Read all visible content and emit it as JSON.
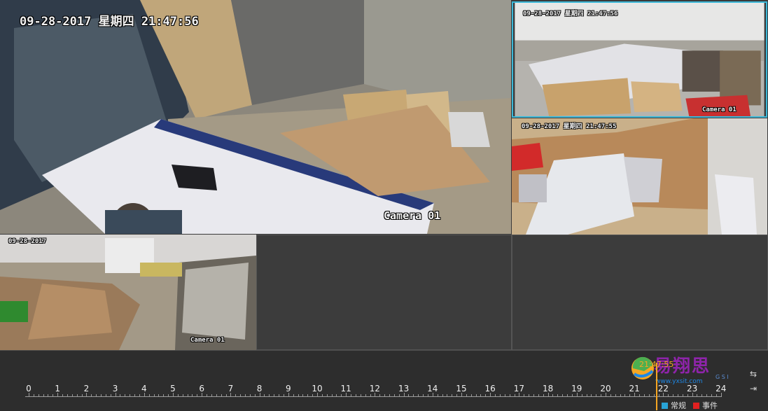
{
  "cameras": [
    {
      "timestamp": "09-28-2017 星期四 21:47:56",
      "name": "Camera 01"
    },
    {
      "timestamp": "09-28-2017 星期四 21:47:56",
      "name": "Camera 01"
    },
    {
      "timestamp": "09-28-2017 星期四 21:47:55",
      "name": "Camera 01"
    },
    {
      "timestamp": "09-28-2017",
      "name": "Camera 01"
    }
  ],
  "timeline": {
    "hours": [
      "0",
      "1",
      "2",
      "3",
      "4",
      "5",
      "6",
      "7",
      "8",
      "9",
      "10",
      "11",
      "12",
      "13",
      "14",
      "15",
      "16",
      "17",
      "18",
      "19",
      "20",
      "21",
      "22",
      "23",
      "24"
    ],
    "cursor_time": "21:47:55",
    "legend": {
      "normal": "常规",
      "event": "事件"
    },
    "colors": {
      "normal": "#29a3d6",
      "event": "#e02020",
      "cursor": "#f5a623"
    }
  },
  "watermark": {
    "brand": "易翔思",
    "sub": "G S I",
    "url": "www.yxsit.com"
  },
  "controls": {
    "expand_icon": "expand-horizontal-icon",
    "shrink_icon": "shrink-horizontal-icon"
  }
}
